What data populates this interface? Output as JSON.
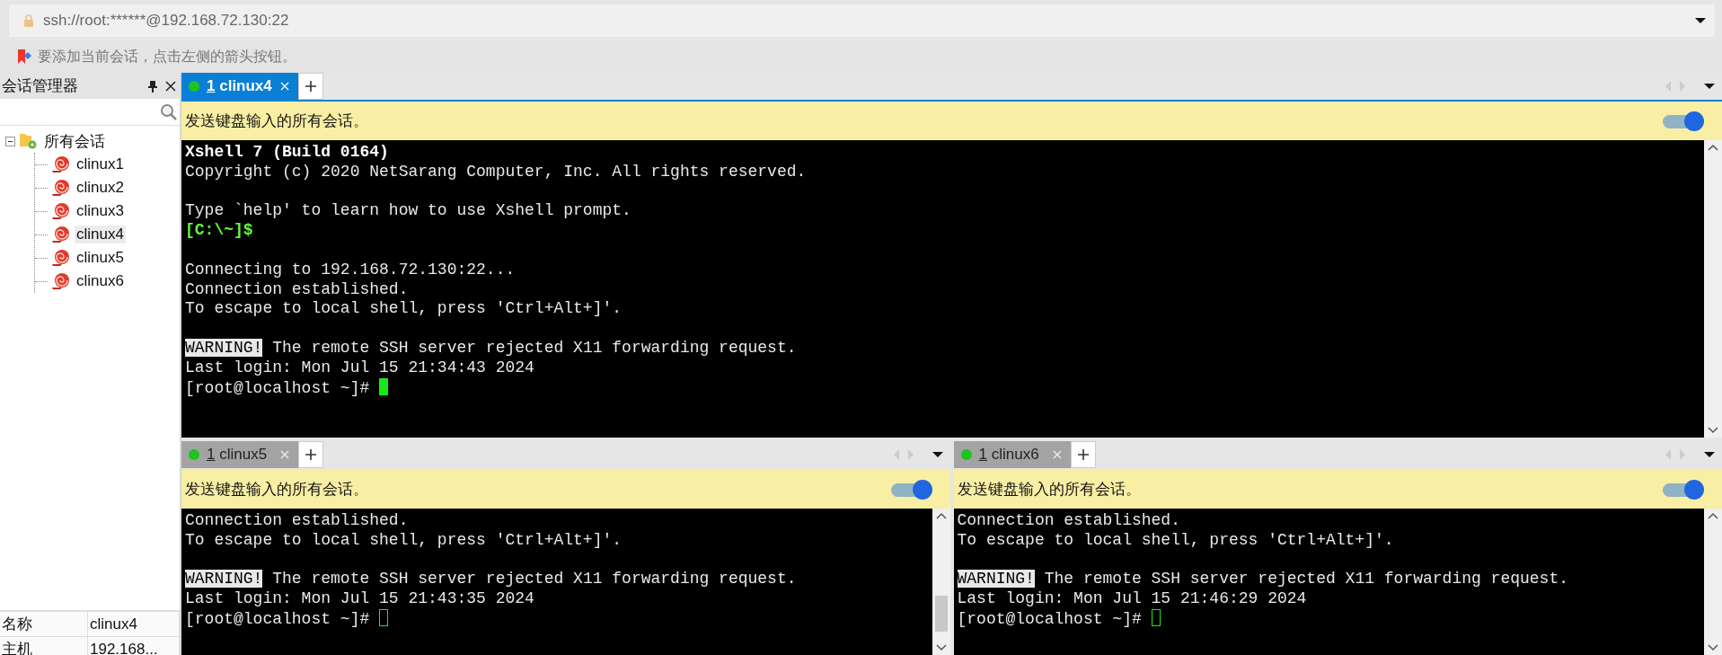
{
  "address_bar": {
    "value": "ssh://root:******@192.168.72.130:22"
  },
  "hint_bar": {
    "text": "要添加当前会话，点击左侧的箭头按钮。"
  },
  "session_manager": {
    "title": "会话管理器",
    "tree": [
      {
        "label": "所有会话",
        "expanded": true,
        "selected": false,
        "children": [
          {
            "label": "clinux1",
            "selected": false
          },
          {
            "label": "clinux2",
            "selected": false
          },
          {
            "label": "clinux3",
            "selected": false
          },
          {
            "label": "clinux4",
            "selected": true
          },
          {
            "label": "clinux5",
            "selected": false
          },
          {
            "label": "clinux6",
            "selected": false
          }
        ]
      }
    ],
    "properties": [
      {
        "key": "名称",
        "value": "clinux4"
      },
      {
        "key": "主机",
        "value": "192.168..."
      }
    ]
  },
  "panes": [
    {
      "tab": {
        "number": "1",
        "label": "clinux4",
        "selected": true,
        "connected": true
      },
      "send_all": {
        "text": "发送键盘输入的所有会话。",
        "on": true
      },
      "scroll_thumb": false,
      "lines": [
        {
          "kind": "bold",
          "text": "Xshell 7 (Build 0164)"
        },
        {
          "kind": "normal",
          "text": "Copyright (c) 2020 NetSarang Computer, Inc. All rights reserved."
        },
        {
          "kind": "blank"
        },
        {
          "kind": "normal",
          "text": "Type `help' to learn how to use Xshell prompt."
        },
        {
          "kind": "local",
          "text": "[C:\\~]$"
        },
        {
          "kind": "blank"
        },
        {
          "kind": "normal",
          "text": "Connecting to 192.168.72.130:22..."
        },
        {
          "kind": "normal",
          "text": "Connection established."
        },
        {
          "kind": "normal",
          "text": "To escape to local shell, press 'Ctrl+Alt+]'."
        },
        {
          "kind": "blank"
        },
        {
          "kind": "warning",
          "tag": "WARNING!",
          "text": " The remote SSH server rejected X11 forwarding request."
        },
        {
          "kind": "normal",
          "text": "Last login: Mon Jul 15 21:34:43 2024"
        },
        {
          "kind": "prompt",
          "text": "[root@localhost ~]# ",
          "focused": true
        }
      ]
    },
    {
      "tab": {
        "number": "1",
        "label": "clinux5",
        "selected": false,
        "connected": true
      },
      "send_all": {
        "text": "发送键盘输入的所有会话。",
        "on": true
      },
      "scroll_thumb": true,
      "lines": [
        {
          "kind": "normal",
          "text": "Connection established."
        },
        {
          "kind": "normal",
          "text": "To escape to local shell, press 'Ctrl+Alt+]'."
        },
        {
          "kind": "blank"
        },
        {
          "kind": "warning",
          "tag": "WARNING!",
          "text": " The remote SSH server rejected X11 forwarding request."
        },
        {
          "kind": "normal",
          "text": "Last login: Mon Jul 15 21:43:35 2024"
        },
        {
          "kind": "prompt",
          "text": "[root@localhost ~]# ",
          "focused": false
        }
      ]
    },
    {
      "tab": {
        "number": "1",
        "label": "clinux6",
        "selected": false,
        "connected": true
      },
      "send_all": {
        "text": "发送键盘输入的所有会话。",
        "on": true
      },
      "scroll_thumb": false,
      "lines": [
        {
          "kind": "normal",
          "text": "Connection established."
        },
        {
          "kind": "normal",
          "text": "To escape to local shell, press 'Ctrl+Alt+]'."
        },
        {
          "kind": "blank"
        },
        {
          "kind": "warning",
          "tag": "WARNING!",
          "text": " The remote SSH server rejected X11 forwarding request."
        },
        {
          "kind": "normal",
          "text": "Last login: Mon Jul 15 21:46:29 2024"
        },
        {
          "kind": "prompt",
          "text": "[root@localhost ~]# ",
          "focused": false
        }
      ]
    }
  ]
}
